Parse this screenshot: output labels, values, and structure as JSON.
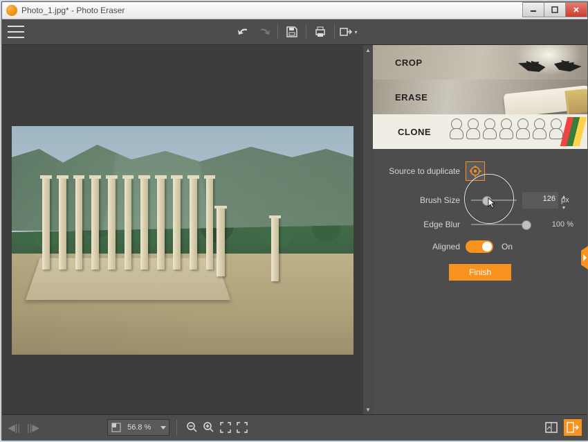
{
  "window": {
    "title": "Photo_1.jpg* - Photo Eraser"
  },
  "panels": {
    "crop": {
      "label": "CROP"
    },
    "erase": {
      "label": "ERASE"
    },
    "clone": {
      "label": "CLONE",
      "source_label": "Source to duplicate",
      "brush_size_label": "Brush Size",
      "brush_size_value": "126",
      "brush_size_unit": "px",
      "brush_size_slider_pct": 35,
      "edge_blur_label": "Edge Blur",
      "edge_blur_value": "100 %",
      "edge_blur_slider_pct": 100,
      "aligned_label": "Aligned",
      "aligned_state": "On",
      "finish_label": "Finish"
    }
  },
  "status": {
    "zoom": "56.8 %"
  },
  "icons": {
    "undo": "undo-icon",
    "redo": "redo-icon",
    "save": "save-icon",
    "print": "print-icon",
    "export": "export-icon",
    "zoom_out": "zoom-out-icon",
    "zoom_in": "zoom-in-icon",
    "fit": "fit-screen-icon",
    "actual": "actual-size-icon"
  }
}
